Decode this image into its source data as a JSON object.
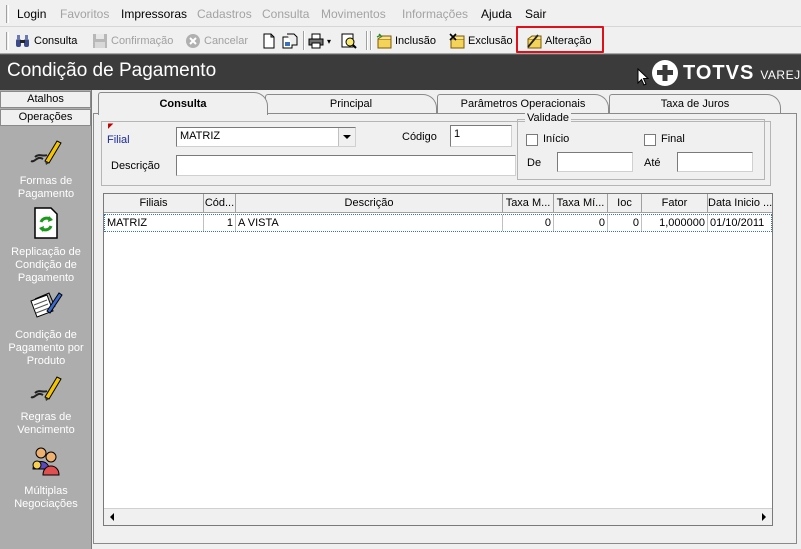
{
  "menu": {
    "items": [
      {
        "label": "Login",
        "enabled": true
      },
      {
        "label": "Favoritos",
        "enabled": false
      },
      {
        "label": "Impressoras",
        "enabled": true
      },
      {
        "label": "Cadastros",
        "enabled": false
      },
      {
        "label": "Consulta",
        "enabled": false
      },
      {
        "label": "Movimentos",
        "enabled": false
      },
      {
        "label": "Informações",
        "enabled": false
      },
      {
        "label": "Ajuda",
        "enabled": true
      },
      {
        "label": "Sair",
        "enabled": true
      }
    ]
  },
  "toolbar": {
    "consulta": "Consulta",
    "confirmacao": "Confirmação",
    "cancelar": "Cancelar",
    "inclusao": "Inclusão",
    "exclusao": "Exclusão",
    "alteracao": "Alteração"
  },
  "colors": {
    "highlight": "#e0101a",
    "header_bg": "#3b3b3b",
    "sidebar_bg": "#adadad"
  },
  "header": {
    "title": "Condição de Pagamento",
    "logo_brand": "TOTVS",
    "logo_sub": "VAREJO"
  },
  "sidebar": {
    "tabs": [
      "Atalhos",
      "Operações"
    ],
    "items": [
      {
        "label": "Formas de Pagamento",
        "icon": "pen-pencil-icon"
      },
      {
        "label": "Replicação de Condição de Pagamento",
        "icon": "refresh-document-icon"
      },
      {
        "label": "Condição de Pagamento por Produto",
        "icon": "documents-pen-icon"
      },
      {
        "label": "Regras de Vencimento",
        "icon": "pen-pencil-icon"
      },
      {
        "label": "Múltiplas Negociações",
        "icon": "people-group-icon"
      }
    ]
  },
  "tabs": [
    "Consulta",
    "Principal",
    "Parâmetros Operacionais",
    "Taxa de Juros"
  ],
  "form": {
    "filial_label": "Filial",
    "filial_value": "MATRIZ",
    "codigo_label": "Código",
    "codigo_value": "1",
    "descricao_label": "Descrição",
    "descricao_value": "",
    "validade": {
      "legend": "Validade",
      "inicio": "Início",
      "final": "Final",
      "de": "De",
      "ate": "Até"
    }
  },
  "grid": {
    "headers": [
      "Filiais",
      "Cód...",
      "Descrição",
      "Taxa M...",
      "Taxa Mí...",
      "Ioc",
      "Fator",
      "Data Inicio ..."
    ],
    "rows": [
      [
        "MATRIZ",
        "1",
        "A VISTA",
        "0",
        "0",
        "0",
        "1,000000",
        "01/10/2011"
      ]
    ]
  }
}
